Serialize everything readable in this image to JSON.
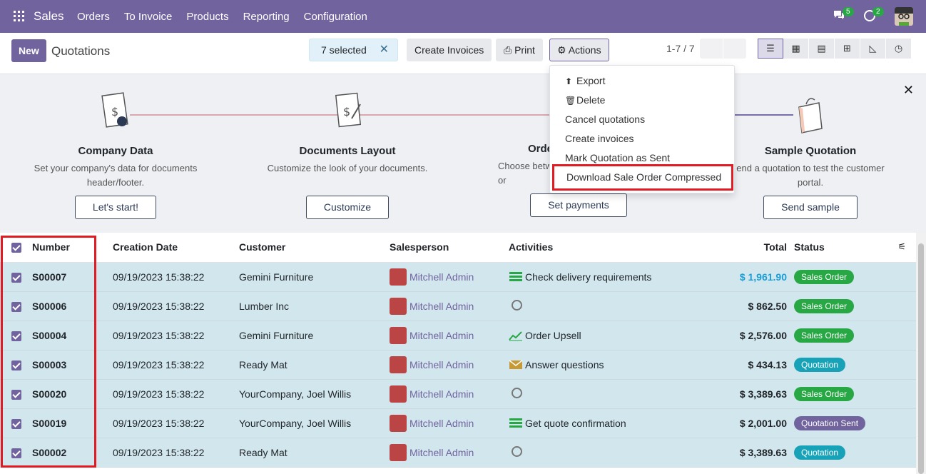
{
  "nav": {
    "brand": "Sales",
    "menu": [
      "Orders",
      "To Invoice",
      "Products",
      "Reporting",
      "Configuration"
    ],
    "chat_count": "5",
    "activity_count": "2"
  },
  "control": {
    "new_label": "New",
    "title": "Quotations",
    "selected_text": "7 selected",
    "create_invoices": "Create Invoices",
    "print": "Print",
    "actions": "Actions",
    "pager": "1-7 / 7"
  },
  "actions_menu": {
    "items": [
      "Export",
      "Delete",
      "Cancel quotations",
      "Create invoices",
      "Mark Quotation as Sent",
      "Download Sale Order Compressed"
    ]
  },
  "onboarding": {
    "steps": [
      {
        "title": "Company Data",
        "desc": "Set your company's data for documents header/footer.",
        "button": "Let's start!"
      },
      {
        "title": "Documents Layout",
        "desc": "Customize the look of your documents.",
        "button": "Customize"
      },
      {
        "title": "Orde",
        "desc": "Choose betw or",
        "button": "Set payments"
      },
      {
        "title": "Sample Quotation",
        "desc": "end a quotation to test the customer portal.",
        "button": "Send sample"
      }
    ]
  },
  "table": {
    "headers": {
      "number": "Number",
      "date": "Creation Date",
      "customer": "Customer",
      "salesperson": "Salesperson",
      "activities": "Activities",
      "total": "Total",
      "status": "Status"
    },
    "rows": [
      {
        "number": "S00007",
        "date": "09/19/2023 15:38:22",
        "customer": "Gemini Furniture",
        "salesperson": "Mitchell Admin",
        "activity": "Check delivery requirements",
        "total": "$ 1,961.90",
        "status": "Sales Order"
      },
      {
        "number": "S00006",
        "date": "09/19/2023 15:38:22",
        "customer": "Lumber Inc",
        "salesperson": "Mitchell Admin",
        "activity": "",
        "total": "$ 862.50",
        "status": "Sales Order"
      },
      {
        "number": "S00004",
        "date": "09/19/2023 15:38:22",
        "customer": "Gemini Furniture",
        "salesperson": "Mitchell Admin",
        "activity": "Order Upsell",
        "total": "$ 2,576.00",
        "status": "Sales Order"
      },
      {
        "number": "S00003",
        "date": "09/19/2023 15:38:22",
        "customer": "Ready Mat",
        "salesperson": "Mitchell Admin",
        "activity": "Answer questions",
        "total": "$ 434.13",
        "status": "Quotation"
      },
      {
        "number": "S00020",
        "date": "09/19/2023 15:38:22",
        "customer": "YourCompany, Joel Willis",
        "salesperson": "Mitchell Admin",
        "activity": "",
        "total": "$ 3,389.63",
        "status": "Sales Order"
      },
      {
        "number": "S00019",
        "date": "09/19/2023 15:38:22",
        "customer": "YourCompany, Joel Willis",
        "salesperson": "Mitchell Admin",
        "activity": "Get quote confirmation",
        "total": "$ 2,001.00",
        "status": "Quotation Sent"
      },
      {
        "number": "S00002",
        "date": "09/19/2023 15:38:22",
        "customer": "Ready Mat",
        "salesperson": "Mitchell Admin",
        "activity": "",
        "total": "$ 3,389.63",
        "status": "Quotation"
      }
    ]
  },
  "colors": {
    "brand": "#71639e",
    "row_selected": "#d1e7ed",
    "highlight": "#e01b24"
  }
}
